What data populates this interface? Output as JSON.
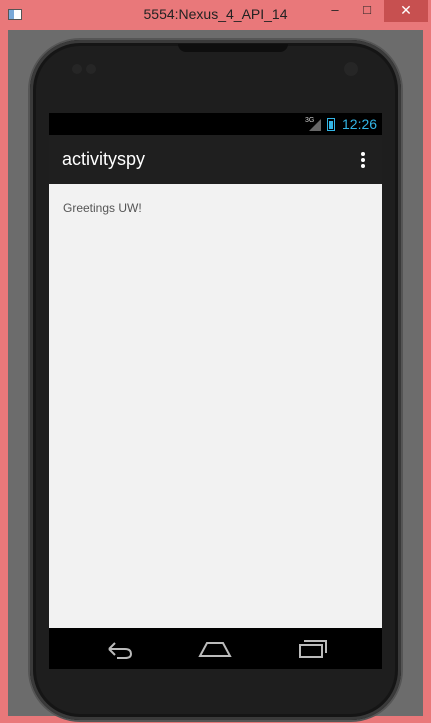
{
  "window": {
    "title": "5554:Nexus_4_API_14",
    "minimize_glyph": "–",
    "maximize_glyph": "□",
    "close_glyph": "✕"
  },
  "status_bar": {
    "signal_label": "3G",
    "time": "12:26"
  },
  "action_bar": {
    "title": "activityspy",
    "overflow_icon": "overflow-menu-icon"
  },
  "content": {
    "greeting": "Greetings UW!"
  },
  "nav_bar": {
    "icons": [
      "back-icon",
      "home-icon",
      "recent-apps-icon"
    ]
  },
  "colors": {
    "window_frame": "#e9787a",
    "accent_blue": "#33b5e5",
    "action_bar": "#1f1f1f",
    "content_bg": "#f2f2f2"
  }
}
